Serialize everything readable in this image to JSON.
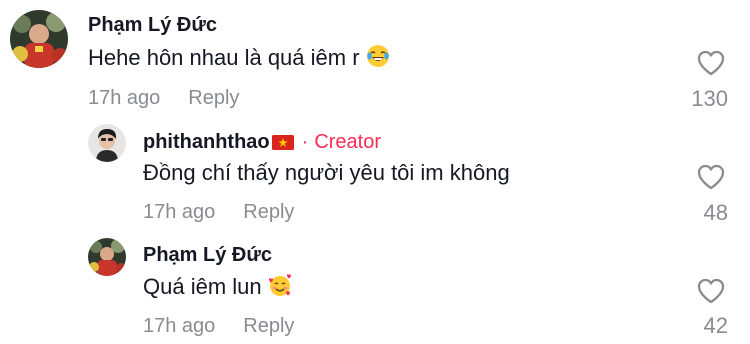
{
  "comments": [
    {
      "username": "Phạm Lý Đức",
      "text": "Hehe hôn nhau là quá iêm r",
      "emoji": "face-with-tears-of-joy",
      "time": "17h ago",
      "reply_label": "Reply",
      "likes": "130"
    },
    {
      "username": "phithanhthao",
      "flag": "vietnam-flag",
      "creator_separator": "·",
      "creator_label": "Creator",
      "text": "Đồng chí thấy người yêu tôi im không",
      "time": "17h ago",
      "reply_label": "Reply",
      "likes": "48"
    },
    {
      "username": "Phạm Lý Đức",
      "text": "Quá iêm lun",
      "emoji": "smiling-face-with-hearts",
      "time": "17h ago",
      "reply_label": "Reply",
      "likes": "42"
    }
  ],
  "colors": {
    "creator": "#fe2c55",
    "meta": "#8a8b91",
    "text": "#161823"
  }
}
